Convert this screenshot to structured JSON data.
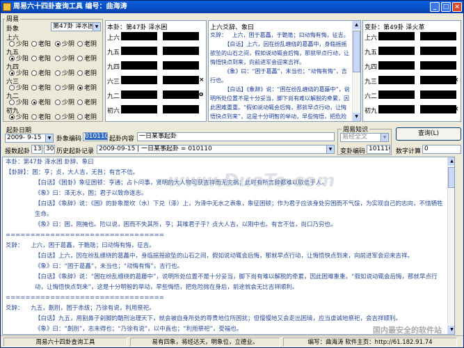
{
  "window": {
    "title": "周易六十四卦查询工具  编号：曲海涛",
    "min": "_",
    "max": "□",
    "close": "×"
  },
  "yao_panel": {
    "group_label": "周易",
    "gua_label": "卦象",
    "selected_gua": "第47卦 泽水困",
    "rows": [
      {
        "name": "上六",
        "options": [
          "少阳",
          "老阳",
          "少阴",
          "老阴"
        ],
        "selected": 2
      },
      {
        "name": "九五",
        "options": [
          "少阳",
          "老阳",
          "少阴",
          "老阴"
        ],
        "selected": 0
      },
      {
        "name": "九四",
        "options": [
          "少阳",
          "老阳",
          "少阴",
          "老阴"
        ],
        "selected": 0
      },
      {
        "name": "六三",
        "options": [
          "少阳",
          "老阳",
          "少阴",
          "老阴"
        ],
        "selected": 3
      },
      {
        "name": "九二",
        "options": [
          "少阳",
          "老阳",
          "少阴",
          "老阴"
        ],
        "selected": 1
      },
      {
        "name": "初九",
        "options": [
          "少阳",
          "老阳",
          "少阴",
          "老阴"
        ],
        "selected": 0
      }
    ]
  },
  "ben_gua": {
    "head": "本卦：第47卦 泽水困",
    "lines": [
      "上六",
      "九五",
      "九四",
      "六三",
      "九二",
      "初六"
    ],
    "marks": [
      "",
      "",
      "",
      "×",
      "o",
      ""
    ]
  },
  "change_text": {
    "head": "上六爻辞、象曰",
    "body": "爻辞：   上六，困于葛藟，于臲卼；曰动悔有悔，征吉。\n        【白话】上六，因在纷乱缠绕的葛藟中，身临摇摇欲坠的山石之间，假如说动辄会后悔，那就早点行动，让悔悟快点到来，向前进军会迎来吉祥。\n        《象》曰：“困于葛藟”，未当也；“动悔有悔”，吉行也。\n        【白话】《象辞》说：“困在纷乱缠绕的葛藤中”，说明所处位置不是十分妥当，脚下尚有难以解脱的牵累，因此困难重重。“假如说动辄会后悔，那就早点行动，让悔悟快点到来”，这是十分明智的举动，早些悔悟，把危险抛在身后，前途就会无比吉祥顺利。"
  },
  "bian_gua": {
    "head": "变卦：第49卦 泽火革",
    "lines": [
      "上六",
      "九五",
      "九四",
      "九三",
      "六二",
      "初九"
    ],
    "marks": [
      "",
      "",
      "",
      "×",
      "",
      "×"
    ]
  },
  "form": {
    "date_label": "起卦日期",
    "date_value": "2009- 9-15",
    "hexcode_label": "卦象编码",
    "hexcode_value": "010110",
    "content_label": "起卦内容",
    "content_value": "一日某事起卦",
    "count_label": "报数起卦",
    "count_a": "13",
    "count_b": "30",
    "history_label": "历史起卦记录",
    "history_value": "2009-09-15   |   一日某事起卦   =  010110",
    "knowledge_label": "周易知识",
    "knowledge_value": "易经全文",
    "bian_code_label": "变卦编码",
    "bian_code_value": "101110",
    "query_button": "查询(L)",
    "num_calc_label": "数字计算",
    "num_calc_value": "0"
  },
  "content": {
    "paragraphs": [
      {
        "text": "本卦：第47卦 泽水困 卦辞、象曰",
        "indent": false
      },
      {
        "text": "【卦辞】：困：亨；贞，大人吉，无咎；有言不信。",
        "indent": false
      },
      {
        "text": "【白话】《困卦》象征困顿：亨通；占卜问事，贤明的大人物可获吉祥而无灾祸；此时有所言辞都难以取信于人。",
        "indent": true
      },
      {
        "text": "《象》曰：泽无水，困；君子以致命遂志。",
        "indent": true
      },
      {
        "text": "【白话】《象辞》说：《困》的卦象是坎（水）下兑（泽）上，为泽中无水之表象，象征困顿；作为君子应该身处穷困而不气馁，为实现自己的志向，不惜牺牲生命。",
        "indent": true
      },
      {
        "text": "《象》曰：困，刚掩也。险以说，困而不失其所，亨；其唯君子乎？贞大人吉，以刚中也。有言不信，尚口乃穷也。",
        "indent": true
      },
      {
        "text": "================================",
        "indent": false
      },
      {
        "text": "爻辞：    上六，困于葛藟，于臲卼；曰动悔有悔，征吉。",
        "indent": false
      },
      {
        "text": "【白话】上六，因在纷乱缠绕的葛藟中，身临摇摇欲坠的山石之间，假如说动辄会后悔，那就早点行动，让悔悟快点到来，向前进军会迎来吉祥。",
        "indent": true
      },
      {
        "text": "《象》曰：“困于葛藟”，未当也；“动悔有悔”，吉行也。",
        "indent": true
      },
      {
        "text": "【白话】《象辞》说：“困在纷乱缠绕的葛藤中”，说明所处位置不是十分妥当，脚下尚有难以解脱的牵累，因此困难重重。“假如说动辄会后悔，那就早点行动，让悔悟快点到来”，这是十分明智的举动，早些悔悟，把危险抛在身后，前途就会无比吉祥顺利。",
        "indent": true
      },
      {
        "text": "================================",
        "indent": false
      },
      {
        "text": "爻辞：    九五，劓刖，困于赤绂；乃徐有说，利用祭祀。",
        "indent": false
      },
      {
        "text": "【白话】九五，用割鼻子剁脚的酷刑治理天下，就会被自身所处的尊贵地位所困扰；但慢慢地又会走出困境，应当虔诚地祭祀，会吉祥顺利。",
        "indent": true
      },
      {
        "text": "《象》曰：“劓刖”，志未得也；“乃徐有说”，以中直也；“利用祭祀”，受福也。",
        "indent": true
      }
    ]
  },
  "status": {
    "cell1": "周易六十四卦查询工具",
    "cell2": "易有四象，将经达天，明象位，立德业。",
    "cell3": "编写：曲海涛   软件主页：http://61.182.91.74"
  },
  "watermark": {
    "main": "www.DuoTe.com",
    "corner": "国内最安全的软件站"
  }
}
